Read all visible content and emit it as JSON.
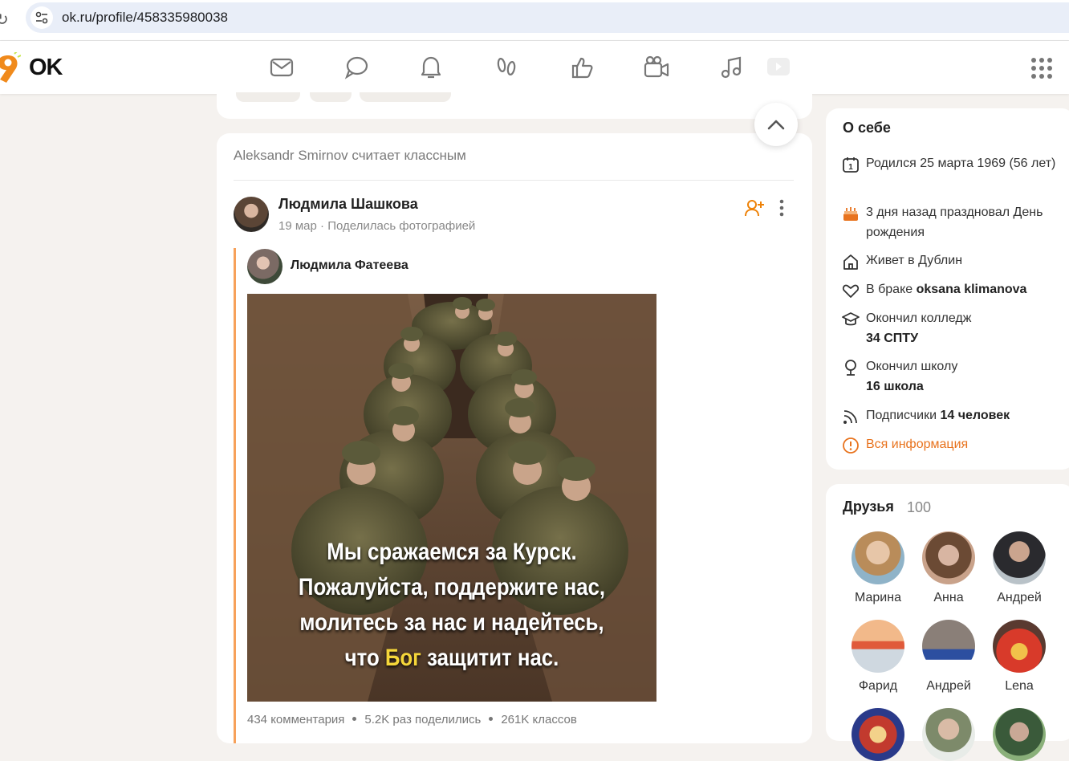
{
  "browser": {
    "url": "ok.ru/profile/458335980038"
  },
  "header": {
    "logo_text": "OK"
  },
  "feed": {
    "liked_by": "Aleksandr Smirnov считает классным",
    "post": {
      "author": "Людмила Шашкова",
      "date": "19 мар",
      "action": "Поделилась фотографией",
      "repost_author": "Людмила Фатеева",
      "photo_caption": {
        "line1": "Мы сражаемся за Курск.",
        "line2": "Пожалуйста, поддержите нас,",
        "line3": "молитесь за нас и надейтесь,",
        "line4_pre": "что ",
        "line4_hl": "Бог",
        "line4_post": " защитит нас."
      },
      "stats": {
        "comments": "434 комментария",
        "shares": "5.2K раз поделились",
        "likes": "261K классов"
      }
    }
  },
  "about": {
    "title": "О себе",
    "born": "Родился 25 марта 1969 (56 лет)",
    "birthday": "3 дня назад праздновал День рождения",
    "lives": "Живет в Дублин",
    "married_pre": "В браке",
    "married_name": "oksana klimanova",
    "college_label": "Окончил колледж",
    "college_name": "34 СПТУ",
    "school_label": "Окончил школу",
    "school_name": "16 школа",
    "subs_label": "Подписчики",
    "subs_value": "14 человек",
    "all_info": "Вся информация"
  },
  "friends": {
    "title": "Друзья",
    "count": "100",
    "list": [
      {
        "name": "Марина"
      },
      {
        "name": "Анна"
      },
      {
        "name": "Андрей"
      },
      {
        "name": "Фарид"
      },
      {
        "name": "Андрей"
      },
      {
        "name": "Lena"
      }
    ]
  },
  "colors": {
    "accent": "#ee8208",
    "link": "#e8731e"
  }
}
